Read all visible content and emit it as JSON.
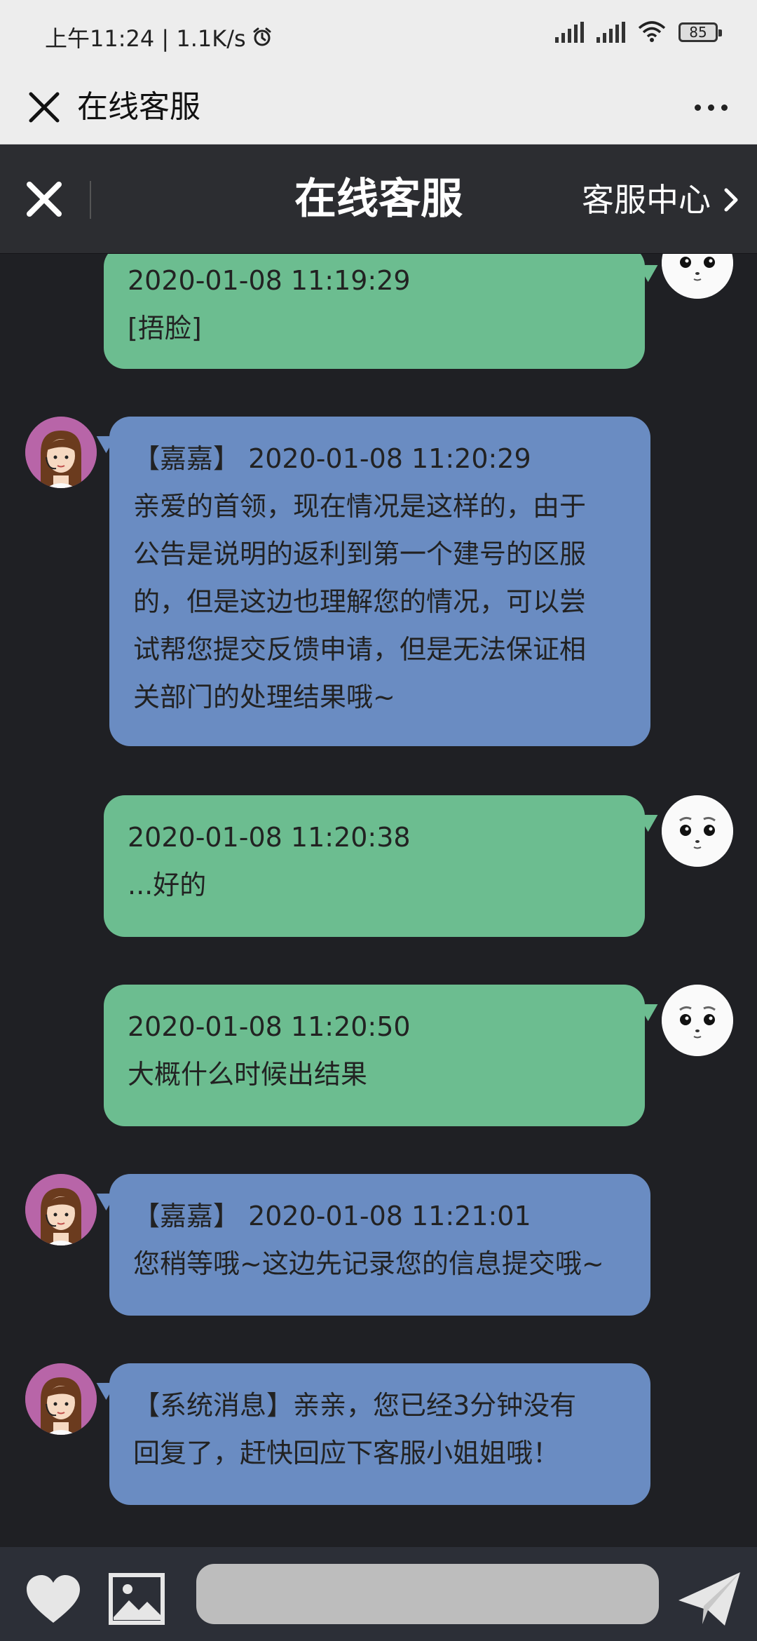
{
  "status_bar": {
    "time": "上午11:24 | 1.1K/s",
    "battery": "85"
  },
  "app_bar": {
    "title": "在线客服"
  },
  "chat_header": {
    "title": "在线客服",
    "center_link": "客服中心"
  },
  "messages": [
    {
      "sender": "user",
      "lines": [
        "2020-01-08 11:19:29",
        "[捂脸]"
      ]
    },
    {
      "sender": "agent",
      "lines": [
        "【嘉嘉】 2020-01-08 11:20:29",
        "亲爱的首领，现在情况是这样的，由于",
        "公告是说明的返利到第一个建号的区服",
        "的，但是这边也理解您的情况，可以尝",
        "试帮您提交反馈申请，但是无法保证相",
        "关部门的处理结果哦~"
      ]
    },
    {
      "sender": "user",
      "lines": [
        "2020-01-08 11:20:38",
        "...好的"
      ]
    },
    {
      "sender": "user",
      "lines": [
        "2020-01-08 11:20:50",
        "大概什么时候出结果"
      ]
    },
    {
      "sender": "agent",
      "lines": [
        "【嘉嘉】 2020-01-08 11:21:01",
        "您稍等哦~这边先记录您的信息提交哦~"
      ]
    },
    {
      "sender": "agent",
      "lines": [
        "【系统消息】亲亲，您已经3分钟没有",
        "回复了，赶快回应下客服小姐姐哦！"
      ]
    }
  ],
  "input": {
    "value": "",
    "placeholder": ""
  },
  "icons": {
    "app_close": "close-icon",
    "more": "more-icon",
    "chat_close": "close-icon",
    "center_arrow": "chevron-right-icon",
    "heart": "heart-icon",
    "image": "image-icon",
    "send": "send-icon"
  },
  "colors": {
    "user_bubble": "#6cbd90",
    "agent_bubble": "#6a8cc2",
    "chat_background": "#1f2024",
    "header_background": "#2c2d31"
  }
}
